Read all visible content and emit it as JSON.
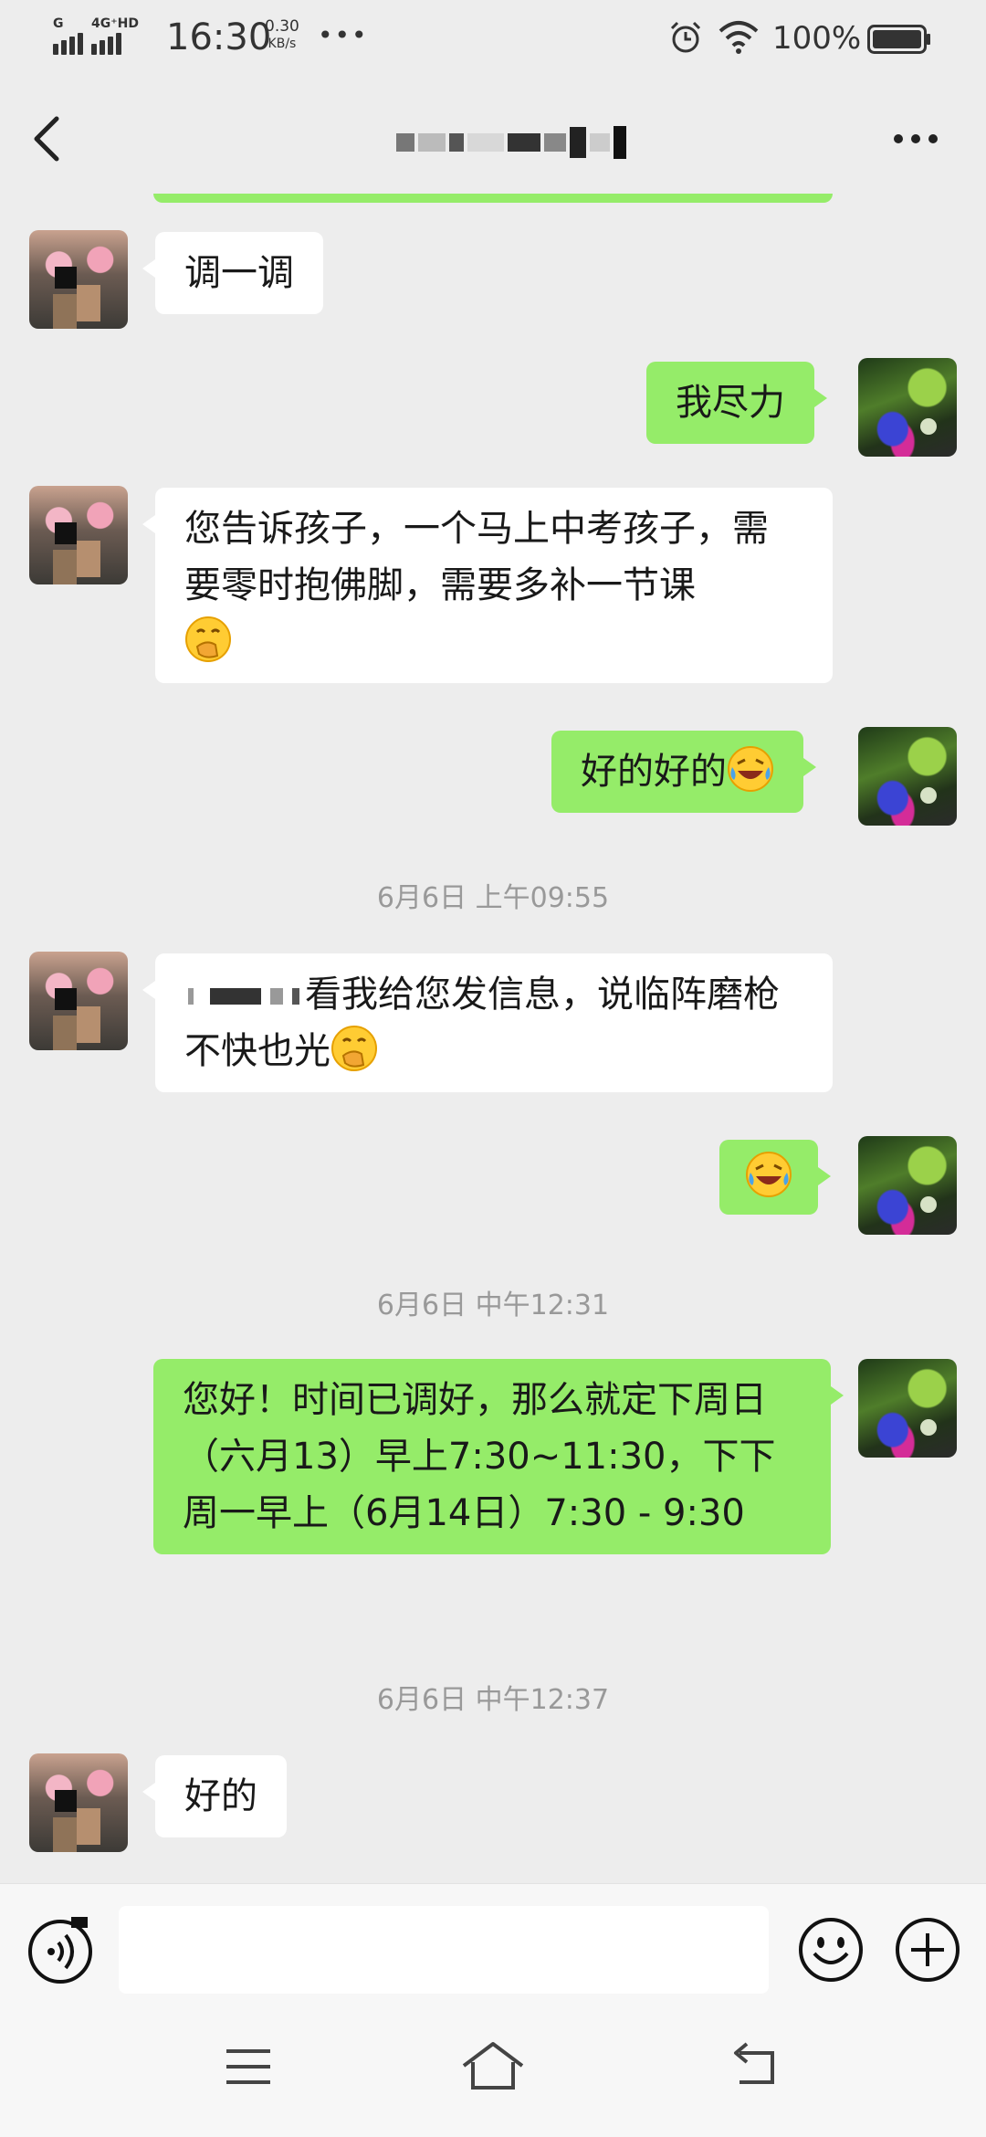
{
  "status_bar": {
    "network_tag_1": "G",
    "network_tag_2": "4G⁺HD",
    "time": "16:30",
    "speed_value": "0.30",
    "speed_unit": "KB/s",
    "more": "•••",
    "battery": "100%"
  },
  "header": {
    "contact_name": "",
    "back_icon": "chevron-left-icon",
    "more_icon": "more-dots-icon"
  },
  "messages": [
    {
      "side": "in",
      "text": "调一调"
    },
    {
      "side": "out",
      "text": "我尽力"
    },
    {
      "side": "in",
      "text": "您告诉孩子，一个马上中考孩子，需要零时抱佛脚，需要多补一节课",
      "emoji": "hand-over-mouth-emoji"
    },
    {
      "side": "out",
      "text": "好的好的",
      "emoji": "laughing-crying-emoji"
    },
    {
      "side": "timestamp",
      "text": "6月6日 上午09:55"
    },
    {
      "side": "in",
      "text_after_redaction": "看我给您发信息，说临阵磨枪不快也光",
      "emoji": "hand-over-mouth-emoji"
    },
    {
      "side": "out",
      "text": "",
      "emoji": "laughing-crying-emoji"
    },
    {
      "side": "timestamp",
      "text": "6月6日 中午12:31"
    },
    {
      "side": "out",
      "text": "您好！时间已调好，那么就定下周日（六月13）早上7:30~11:30，下下周一早上（6月14日）7:30 - 9:30"
    },
    {
      "side": "timestamp",
      "text": "6月6日 中午12:37"
    },
    {
      "side": "in",
      "text": "好的"
    }
  ],
  "input_bar": {
    "placeholder": "",
    "voice_icon": "voice-icon",
    "emoji_icon": "smiley-icon",
    "plus_icon": "plus-circle-icon"
  },
  "nav_bar": {
    "menu_icon": "menu-icon",
    "home_icon": "home-icon",
    "back_icon": "back-icon"
  },
  "colors": {
    "background": "#ededed",
    "outgoing_bubble": "#95ec69",
    "incoming_bubble": "#ffffff",
    "timestamp": "#999999"
  }
}
